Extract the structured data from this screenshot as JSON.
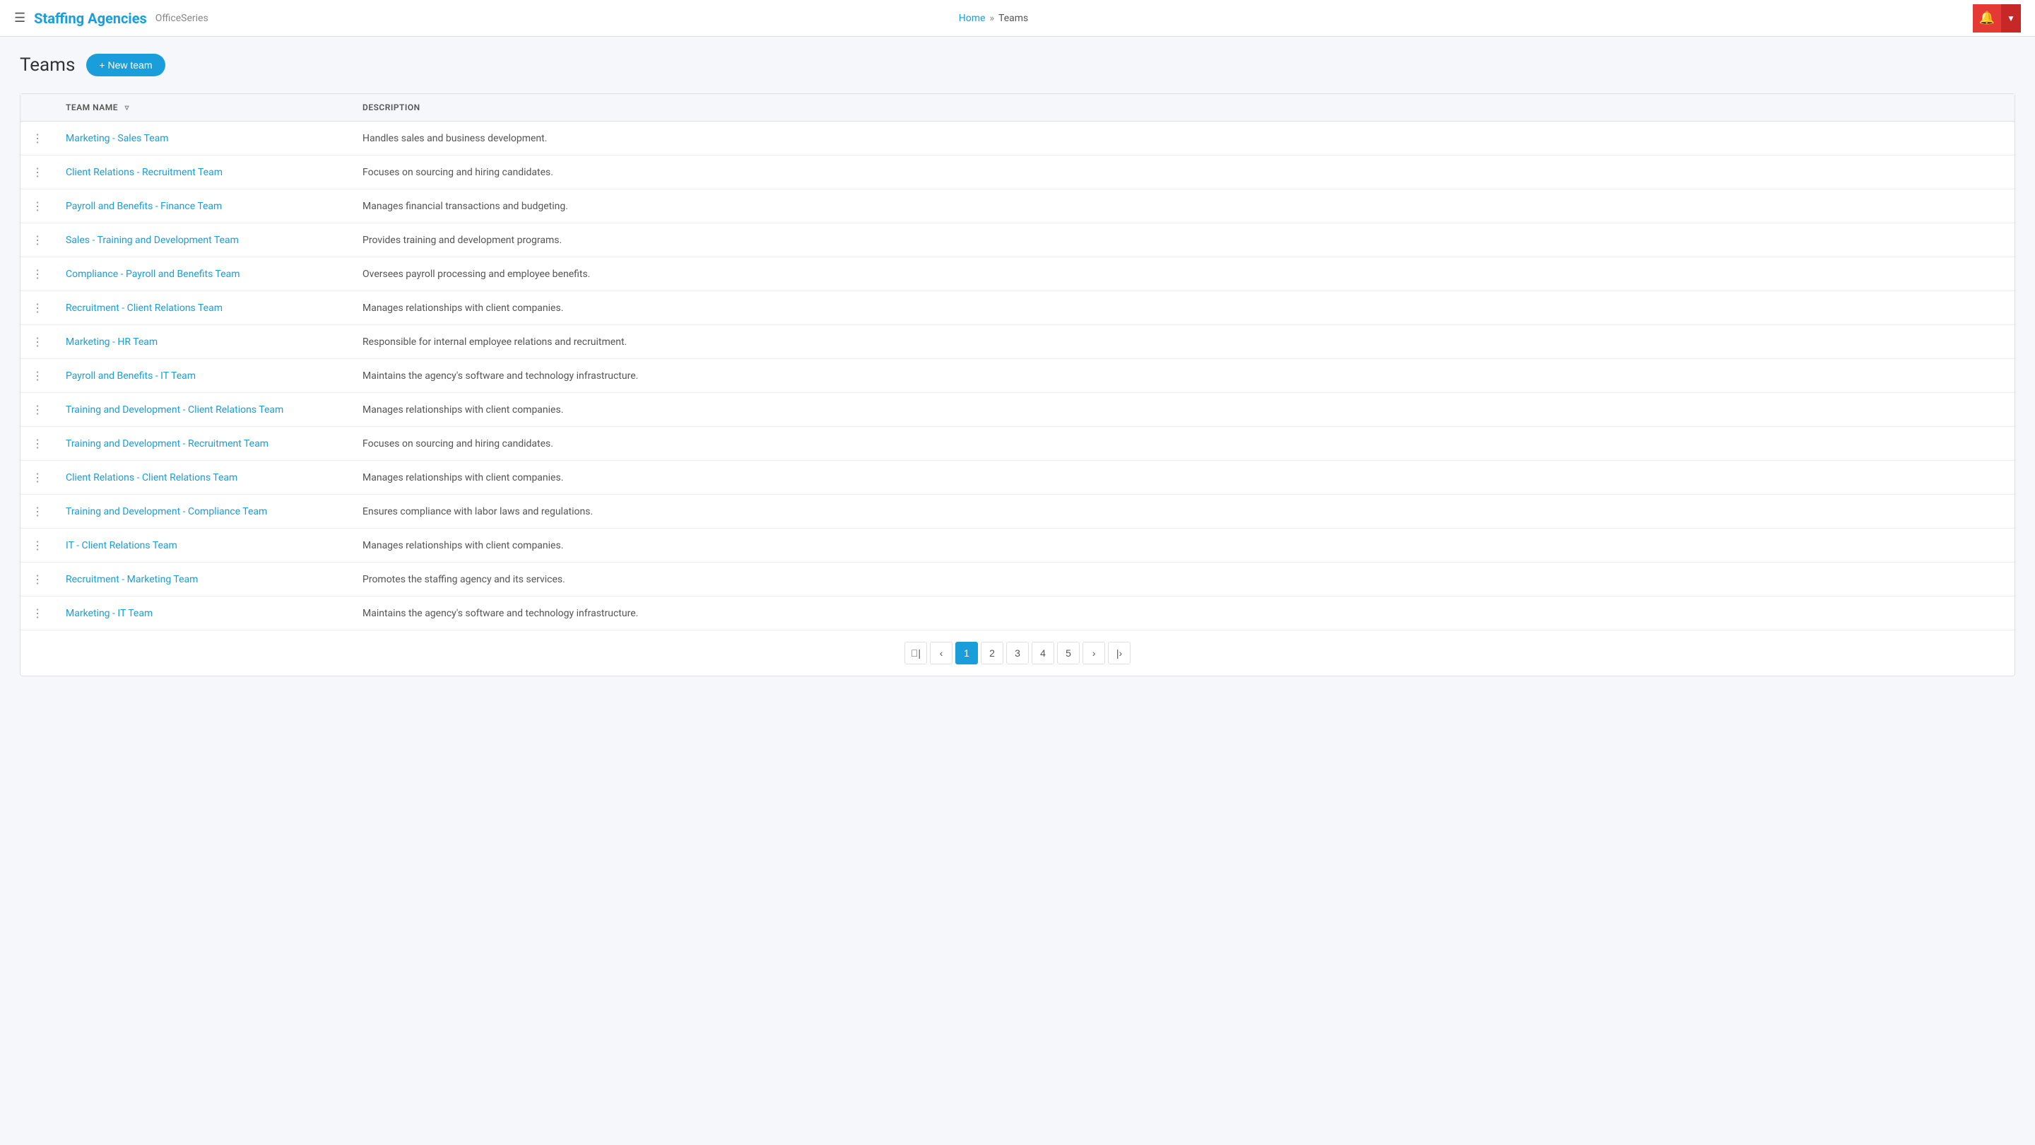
{
  "header": {
    "menu_icon": "☰",
    "app_title": "Staffing Agencies",
    "app_subtitle": "OfficeSeries",
    "nav_home": "Home",
    "nav_separator": "»",
    "nav_current": "Teams",
    "notification_icon": "🔔",
    "dropdown_icon": "▼"
  },
  "page": {
    "title": "Teams",
    "new_team_label": "+ New team"
  },
  "table": {
    "col_menu": "",
    "col_name": "TEAM NAME",
    "col_desc": "DESCRIPTION",
    "rows": [
      {
        "name": "Marketing - Sales Team",
        "description": "Handles sales and business development."
      },
      {
        "name": "Client Relations - Recruitment Team",
        "description": "Focuses on sourcing and hiring candidates."
      },
      {
        "name": "Payroll and Benefits - Finance Team",
        "description": "Manages financial transactions and budgeting."
      },
      {
        "name": "Sales - Training and Development Team",
        "description": "Provides training and development programs."
      },
      {
        "name": "Compliance - Payroll and Benefits Team",
        "description": "Oversees payroll processing and employee benefits."
      },
      {
        "name": "Recruitment - Client Relations Team",
        "description": "Manages relationships with client companies."
      },
      {
        "name": "Marketing - HR Team",
        "description": "Responsible for internal employee relations and recruitment."
      },
      {
        "name": "Payroll and Benefits - IT Team",
        "description": "Maintains the agency's software and technology infrastructure."
      },
      {
        "name": "Training and Development - Client Relations Team",
        "description": "Manages relationships with client companies."
      },
      {
        "name": "Training and Development - Recruitment Team",
        "description": "Focuses on sourcing and hiring candidates."
      },
      {
        "name": "Client Relations - Client Relations Team",
        "description": "Manages relationships with client companies."
      },
      {
        "name": "Training and Development - Compliance Team",
        "description": "Ensures compliance with labor laws and regulations."
      },
      {
        "name": "IT - Client Relations Team",
        "description": "Manages relationships with client companies."
      },
      {
        "name": "Recruitment - Marketing Team",
        "description": "Promotes the staffing agency and its services."
      },
      {
        "name": "Marketing - IT Team",
        "description": "Maintains the agency's software and technology infrastructure."
      }
    ]
  },
  "pagination": {
    "first_icon": "⟨|",
    "prev_icon": "‹",
    "next_icon": "›",
    "last_icon": "|⟩",
    "pages": [
      "1",
      "2",
      "3",
      "4",
      "5"
    ],
    "current_page": "1"
  }
}
